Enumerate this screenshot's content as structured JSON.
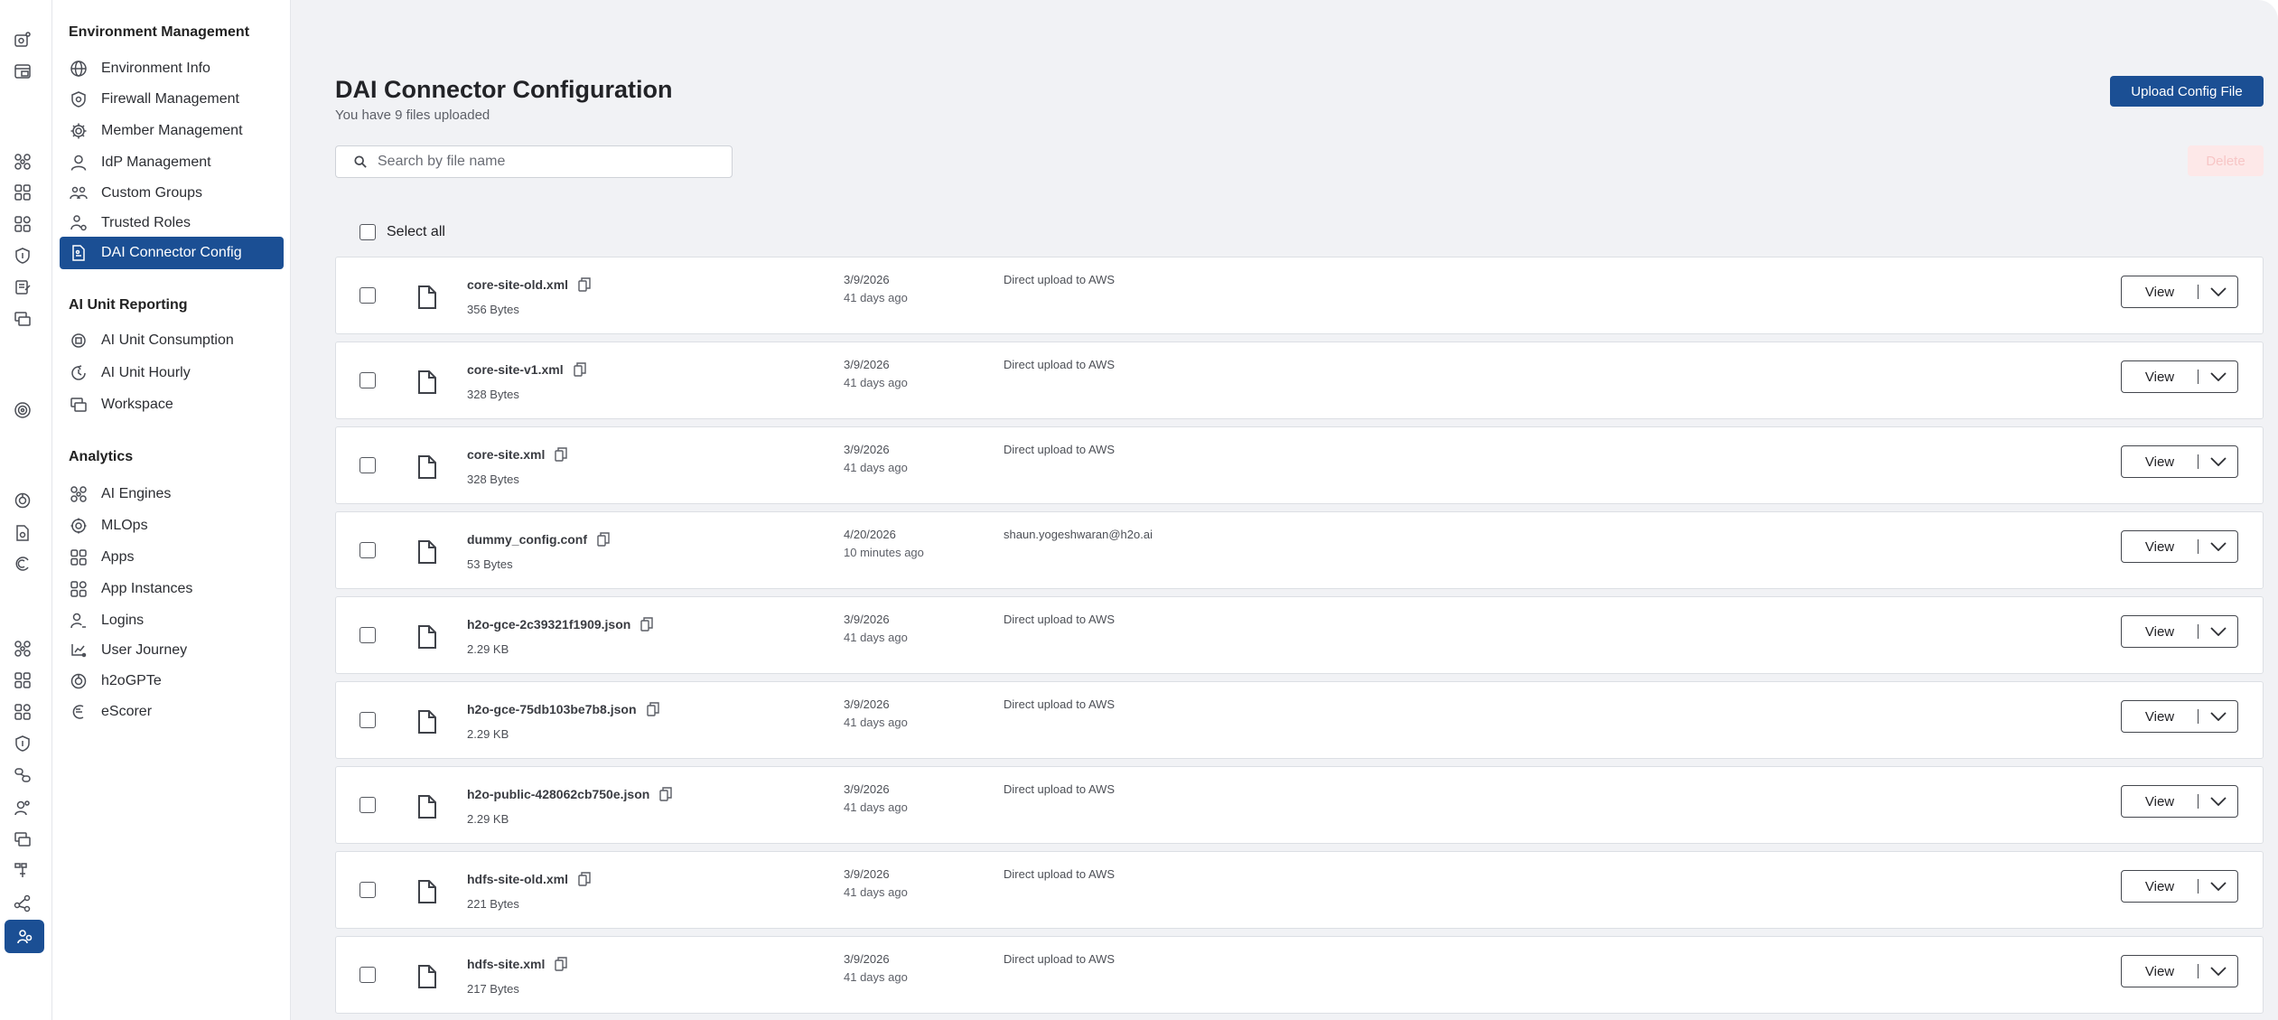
{
  "rail_icons": [
    {
      "name": "bulb-gear-icon",
      "active": false
    },
    {
      "name": "calendar-grid-icon",
      "active": false
    },
    {
      "name": "engines-icon",
      "active": false
    },
    {
      "name": "apps-grid-icon",
      "active": false
    },
    {
      "name": "apps-grid-alt-icon",
      "active": false
    },
    {
      "name": "shield-icon",
      "active": false
    },
    {
      "name": "notes-icon",
      "active": false
    },
    {
      "name": "stacked-windows-icon",
      "active": false
    },
    {
      "name": "target-icon",
      "active": false
    },
    {
      "name": "gpte-icon",
      "active": false
    },
    {
      "name": "document-gear-icon",
      "active": false
    },
    {
      "name": "refresh-c-icon",
      "active": false
    },
    {
      "name": "engines-icon",
      "active": false
    },
    {
      "name": "apps-grid-icon",
      "active": false
    },
    {
      "name": "apps-grid-alt-icon",
      "active": false
    },
    {
      "name": "shield-icon",
      "active": false
    },
    {
      "name": "link-chain-icon",
      "active": false
    },
    {
      "name": "person-gear-icon",
      "active": false
    },
    {
      "name": "stacked-windows-icon",
      "active": false
    },
    {
      "name": "hierarchy-icon",
      "active": false
    },
    {
      "name": "share-nodes-icon",
      "active": false
    },
    {
      "name": "config-hand-icon",
      "active": true
    }
  ],
  "nav": {
    "sections": [
      {
        "title": "Environment Management",
        "items": [
          {
            "label": "Environment Info",
            "icon": "globe-icon"
          },
          {
            "label": "Firewall Management",
            "icon": "firewall-shield-icon"
          },
          {
            "label": "Member Management",
            "icon": "gear-icon"
          },
          {
            "label": "IdP Management",
            "icon": "user-icon"
          },
          {
            "label": "Custom Groups",
            "icon": "group-icon"
          },
          {
            "label": "Trusted Roles",
            "icon": "trusted-roles-icon"
          },
          {
            "label": "DAI Connector Config",
            "icon": "config-doc-icon",
            "active": true
          }
        ]
      },
      {
        "title": "AI Unit Reporting",
        "items": [
          {
            "label": "AI Unit Consumption",
            "icon": "chip-icon"
          },
          {
            "label": "AI Unit Hourly",
            "icon": "clock-refresh-icon"
          },
          {
            "label": "Workspace",
            "icon": "stacked-windows-icon"
          }
        ]
      },
      {
        "title": "Analytics",
        "items": [
          {
            "label": "AI Engines",
            "icon": "engines-icon"
          },
          {
            "label": "MLOps",
            "icon": "mlops-icon"
          },
          {
            "label": "Apps",
            "icon": "apps-grid-icon"
          },
          {
            "label": "App Instances",
            "icon": "apps-grid-alt-icon"
          },
          {
            "label": "Logins",
            "icon": "login-user-icon"
          },
          {
            "label": "User Journey",
            "icon": "journey-icon"
          },
          {
            "label": "h2oGPTe",
            "icon": "gpte-icon"
          },
          {
            "label": "eScorer",
            "icon": "escorer-icon"
          }
        ]
      }
    ]
  },
  "page": {
    "title": "DAI Connector Configuration",
    "subtitle": "You have 9 files uploaded",
    "upload_label": "Upload Config File",
    "delete_label": "Delete",
    "search_placeholder": "Search by file name",
    "select_all_label": "Select all"
  },
  "files": [
    {
      "name": "core-site-old.xml",
      "size": "356 Bytes",
      "date": "3/9/2026",
      "ago": "41 days ago",
      "source": "Direct upload to AWS",
      "view_label": "View"
    },
    {
      "name": "core-site-v1.xml",
      "size": "328 Bytes",
      "date": "3/9/2026",
      "ago": "41 days ago",
      "source": "Direct upload to AWS",
      "view_label": "View"
    },
    {
      "name": "core-site.xml",
      "size": "328 Bytes",
      "date": "3/9/2026",
      "ago": "41 days ago",
      "source": "Direct upload to AWS",
      "view_label": "View"
    },
    {
      "name": "dummy_config.conf",
      "size": "53 Bytes",
      "date": "4/20/2026",
      "ago": "10 minutes ago",
      "source": "shaun.yogeshwaran@h2o.ai",
      "view_label": "View"
    },
    {
      "name": "h2o-gce-2c39321f1909.json",
      "size": "2.29 KB",
      "date": "3/9/2026",
      "ago": "41 days ago",
      "source": "Direct upload to AWS",
      "view_label": "View"
    },
    {
      "name": "h2o-gce-75db103be7b8.json",
      "size": "2.29 KB",
      "date": "3/9/2026",
      "ago": "41 days ago",
      "source": "Direct upload to AWS",
      "view_label": "View"
    },
    {
      "name": "h2o-public-428062cb750e.json",
      "size": "2.29 KB",
      "date": "3/9/2026",
      "ago": "41 days ago",
      "source": "Direct upload to AWS",
      "view_label": "View"
    },
    {
      "name": "hdfs-site-old.xml",
      "size": "221 Bytes",
      "date": "3/9/2026",
      "ago": "41 days ago",
      "source": "Direct upload to AWS",
      "view_label": "View"
    },
    {
      "name": "hdfs-site.xml",
      "size": "217 Bytes",
      "date": "3/9/2026",
      "ago": "41 days ago",
      "source": "Direct upload to AWS",
      "view_label": "View"
    }
  ],
  "colors": {
    "accent": "#1b4f94",
    "main_bg": "#f1f2f5",
    "delete_disabled_bg": "#fde8e8"
  }
}
